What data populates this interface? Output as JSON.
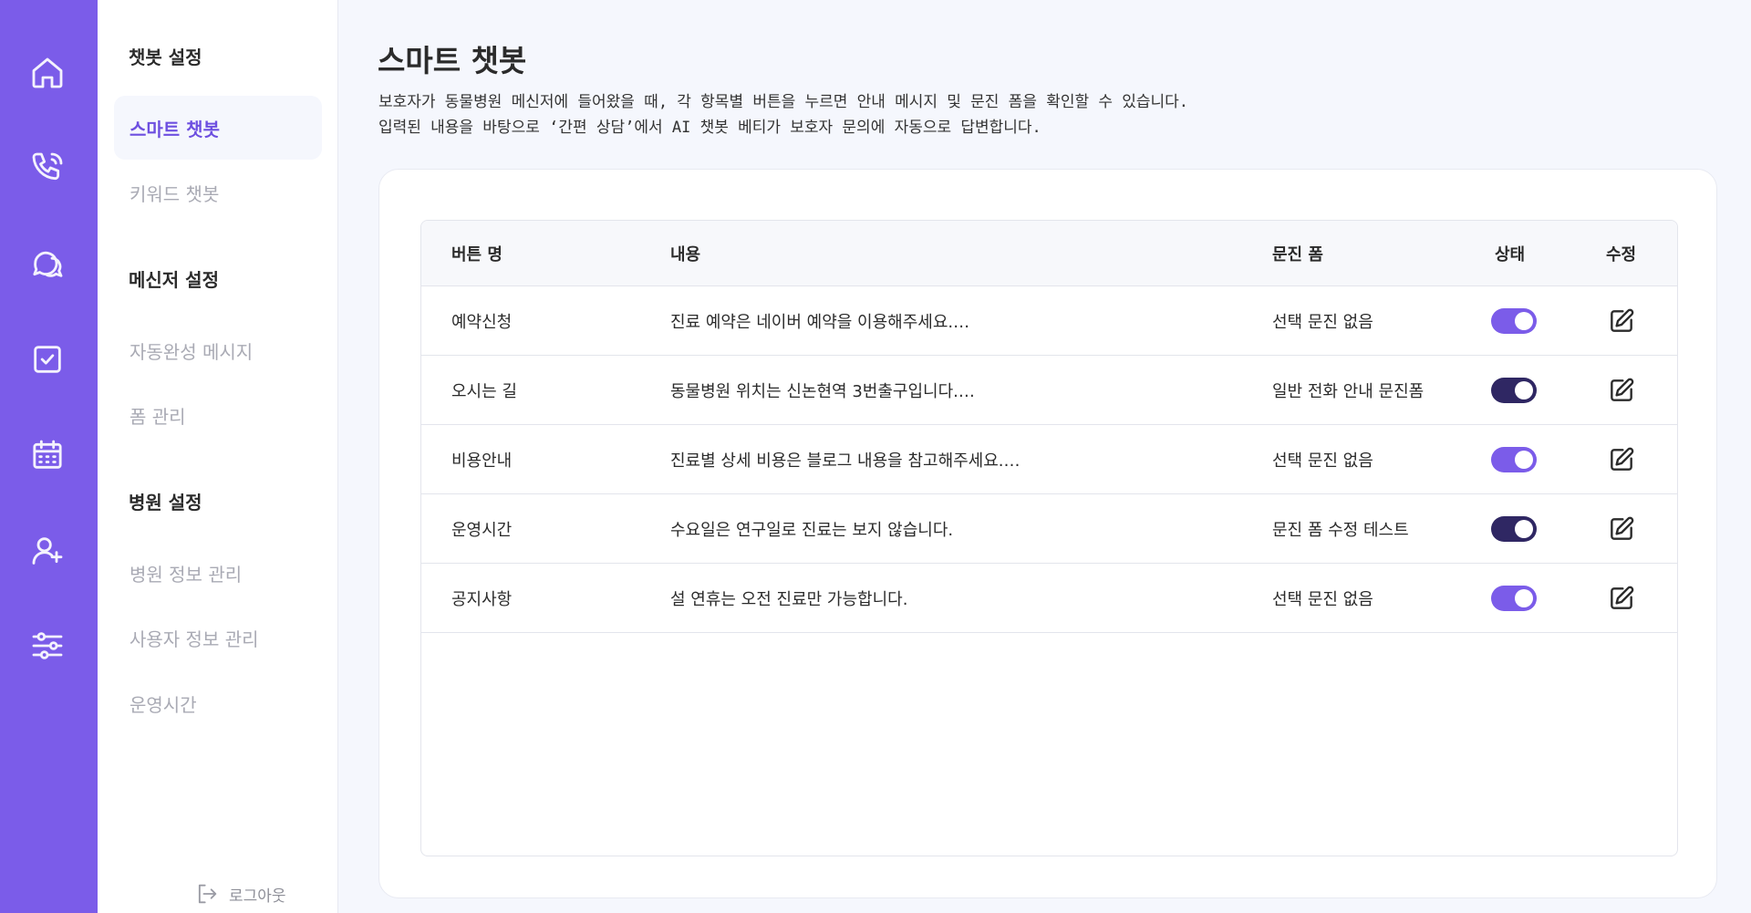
{
  "colors": {
    "rail": "#7b5ce9",
    "accent": "#6d4fe0",
    "toggle_on_light": "#7b5ce9",
    "toggle_on_dark": "#2f2763"
  },
  "rail": {
    "icons": [
      "home-icon",
      "phone-icon",
      "chat-icon",
      "checkbox-icon",
      "calendar-icon",
      "user-add-icon",
      "sliders-icon"
    ]
  },
  "subnav": {
    "chatbot_section": "챗봇 설정",
    "smart_chatbot": "스마트 챗봇",
    "keyword_chatbot": "키워드 챗봇",
    "messenger_section": "메신저 설정",
    "autocomplete_message": "자동완성 메시지",
    "form_management": "폼 관리",
    "hospital_section": "병원 설정",
    "hospital_info": "병원 정보 관리",
    "user_info": "사용자 정보 관리",
    "operating_hours": "운영시간",
    "logout": "로그아웃"
  },
  "main": {
    "title": "스마트 챗봇",
    "description_line1": "보호자가 동물병원 메신저에 들어왔을 때, 각 항목별 버튼을 누르면 안내 메시지 및 문진 폼을 확인할 수 있습니다.",
    "description_line2": "입력된 내용을 바탕으로 ‘간편 상담’에서 AI 챗봇 베티가 보호자 문의에 자동으로 답변합니다."
  },
  "table": {
    "headers": {
      "button_name": "버튼 명",
      "content": "내용",
      "form": "문진 폼",
      "status": "상태",
      "edit": "수정"
    },
    "rows": [
      {
        "button_name": "예약신청",
        "content": "진료 예약은 네이버 예약을 이용해주세요.…",
        "form": "선택 문진 없음",
        "status_on": true,
        "toggle_color": "#7b5ce9"
      },
      {
        "button_name": "오시는 길",
        "content": "동물병원 위치는 신논현역 3번출구입니다.…",
        "form": "일반 전화 안내 문진폼",
        "status_on": true,
        "toggle_color": "#2f2763"
      },
      {
        "button_name": "비용안내",
        "content": "진료별 상세 비용은 블로그 내용을 참고해주세요.…",
        "form": "선택 문진 없음",
        "status_on": true,
        "toggle_color": "#7b5ce9"
      },
      {
        "button_name": "운영시간",
        "content": "수요일은 연구일로 진료는 보지 않습니다.",
        "form": "문진 폼 수정 테스트",
        "status_on": true,
        "toggle_color": "#2f2763"
      },
      {
        "button_name": "공지사항",
        "content": "설 연휴는 오전 진료만 가능합니다.",
        "form": "선택 문진 없음",
        "status_on": true,
        "toggle_color": "#7b5ce9"
      }
    ]
  }
}
